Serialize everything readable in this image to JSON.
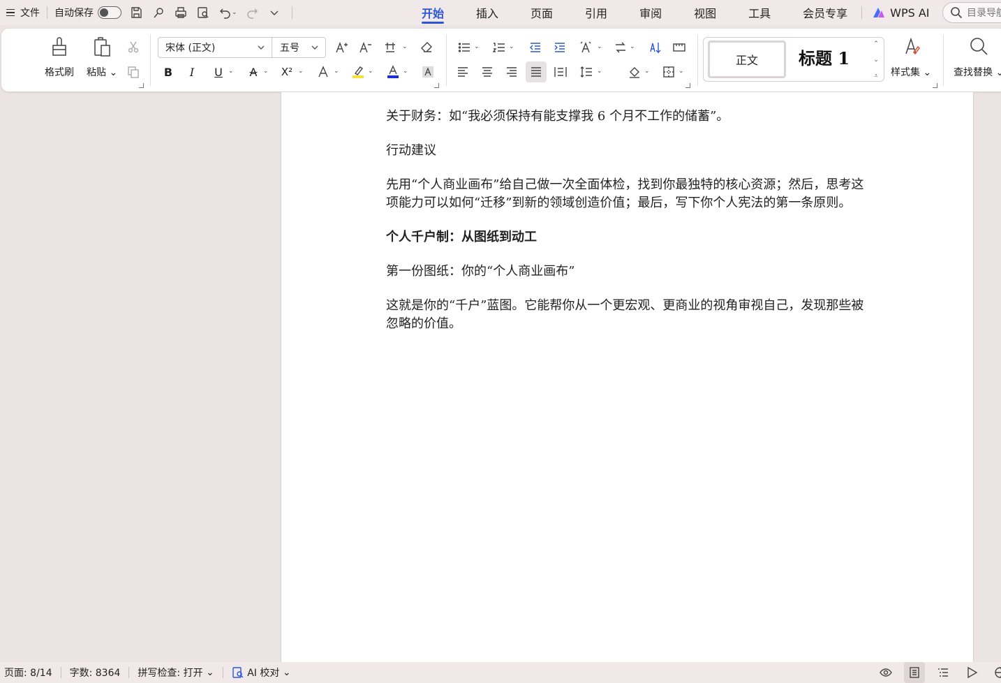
{
  "menubar": {
    "file_label": "文件",
    "autosave_label": "自动保存",
    "autosave_on": false,
    "tabs": [
      {
        "label": "开始",
        "active": true
      },
      {
        "label": "插入",
        "active": false
      },
      {
        "label": "页面",
        "active": false
      },
      {
        "label": "引用",
        "active": false
      },
      {
        "label": "审阅",
        "active": false
      },
      {
        "label": "视图",
        "active": false
      },
      {
        "label": "工具",
        "active": false
      },
      {
        "label": "会员专享",
        "active": false
      }
    ],
    "wps_ai_label": "WPS AI",
    "search_placeholder": "目录导航"
  },
  "ribbon": {
    "format_painter_label": "格式刷",
    "paste_label": "粘贴",
    "font_name": "宋体 (正文)",
    "font_size": "五号",
    "bold_label": "B",
    "italic_label": "I",
    "underline_label": "U",
    "strike_label": "A",
    "superscript_label": "X²",
    "font_color_hex": "#1a2fd6",
    "highlight_hex": "#f4e23a",
    "styles": {
      "normal_label": "正文",
      "heading1_label": "标题 1"
    },
    "style_set_label": "样式集",
    "find_replace_label": "查找替换"
  },
  "document": {
    "paragraphs": [
      {
        "text": "关于财务：如“我必须保持有能支撑我 6 个月不工作的储蓄”。",
        "bold": false
      },
      {
        "text": "行动建议",
        "bold": false
      },
      {
        "text": "先用“个人商业画布”给自己做一次全面体检，找到你最独特的核心资源；然后，思考这项能力可以如何“迁移”到新的领域创造价值；最后，写下你个人宪法的第一条原则。",
        "bold": false
      },
      {
        "text": "个人千户制：从图纸到动工",
        "bold": true
      },
      {
        "text": "第一份图纸：你的“个人商业画布”",
        "bold": false
      },
      {
        "text": "这就是你的“千户”蓝图。它能帮你从一个更宏观、更商业的视角审视自己，发现那些被忽略的价值。",
        "bold": false
      }
    ]
  },
  "statusbar": {
    "page_info": "页面: 8/14",
    "word_count": "字数: 8364",
    "spell_check": "拼写检查: 打开",
    "ai_proof": "AI 校对"
  },
  "colors": {
    "accent": "#2b57d6",
    "chrome_bg": "#f0e8e9",
    "canvas_bg": "#ece3e4"
  }
}
